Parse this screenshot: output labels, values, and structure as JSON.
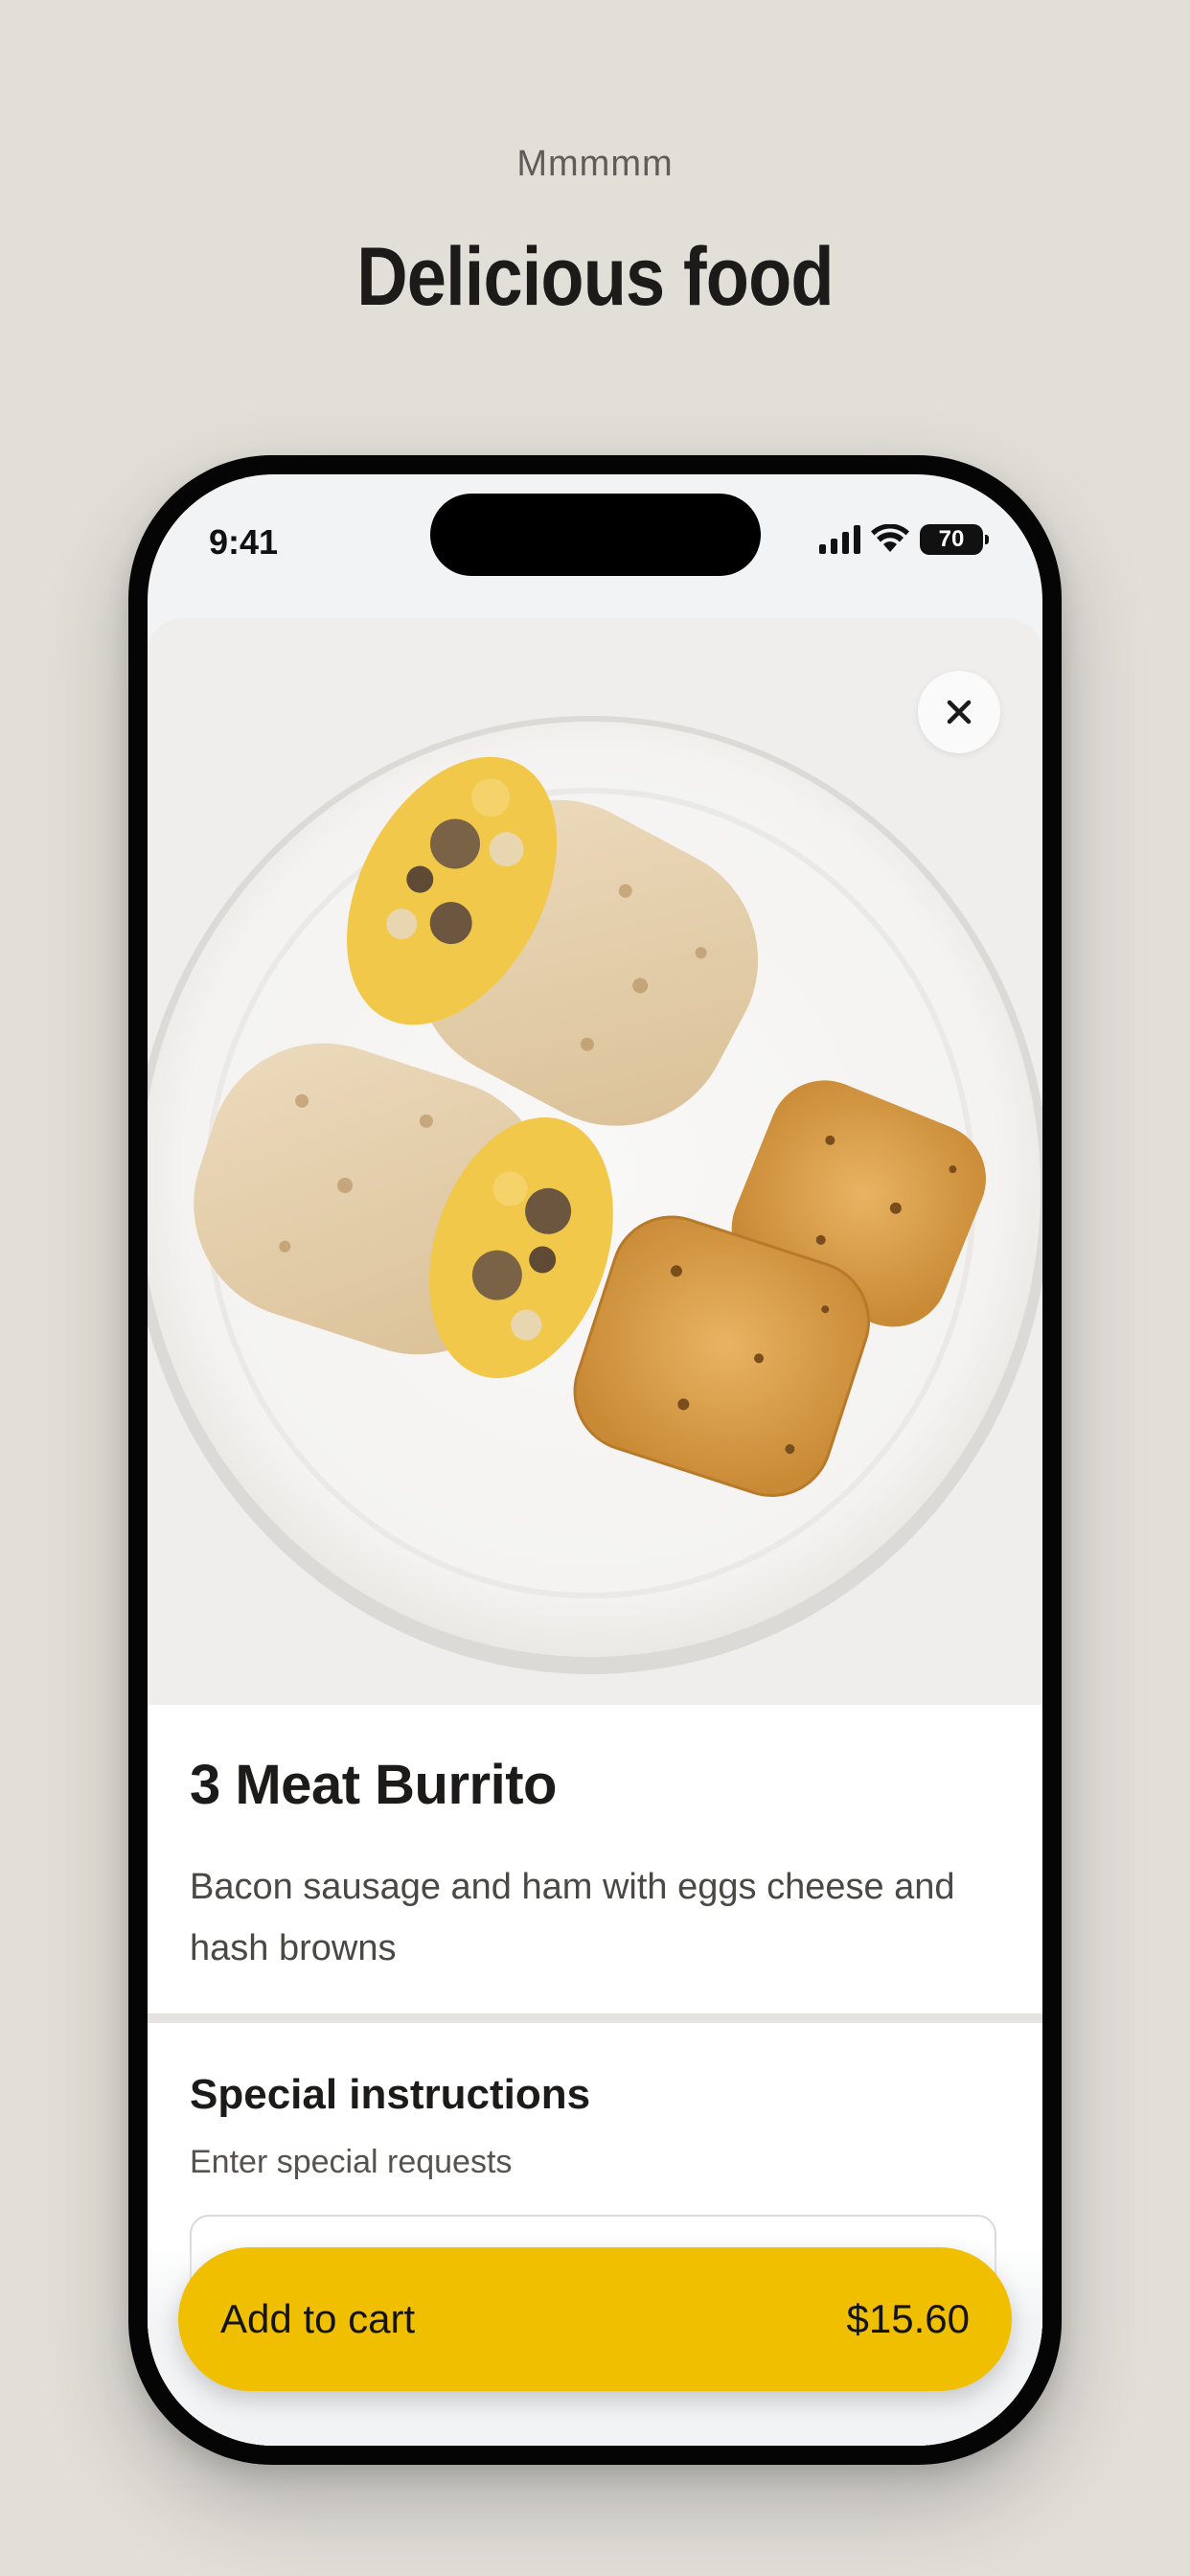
{
  "page": {
    "eyebrow": "Mmmmm",
    "headline": "Delicious food"
  },
  "status_bar": {
    "time": "9:41",
    "battery": "70"
  },
  "product": {
    "image_icon": "burrito-photo",
    "title": "3 Meat Burrito",
    "description": "Bacon sausage and ham with eggs cheese and hash browns"
  },
  "instructions": {
    "title": "Special instructions",
    "subtitle": "Enter special requests",
    "value": ""
  },
  "cart": {
    "label": "Add to cart",
    "price": "$15.60"
  },
  "colors": {
    "background": "#e2dfd9",
    "accent": "#f0c000",
    "text": "#1c1b1a"
  }
}
